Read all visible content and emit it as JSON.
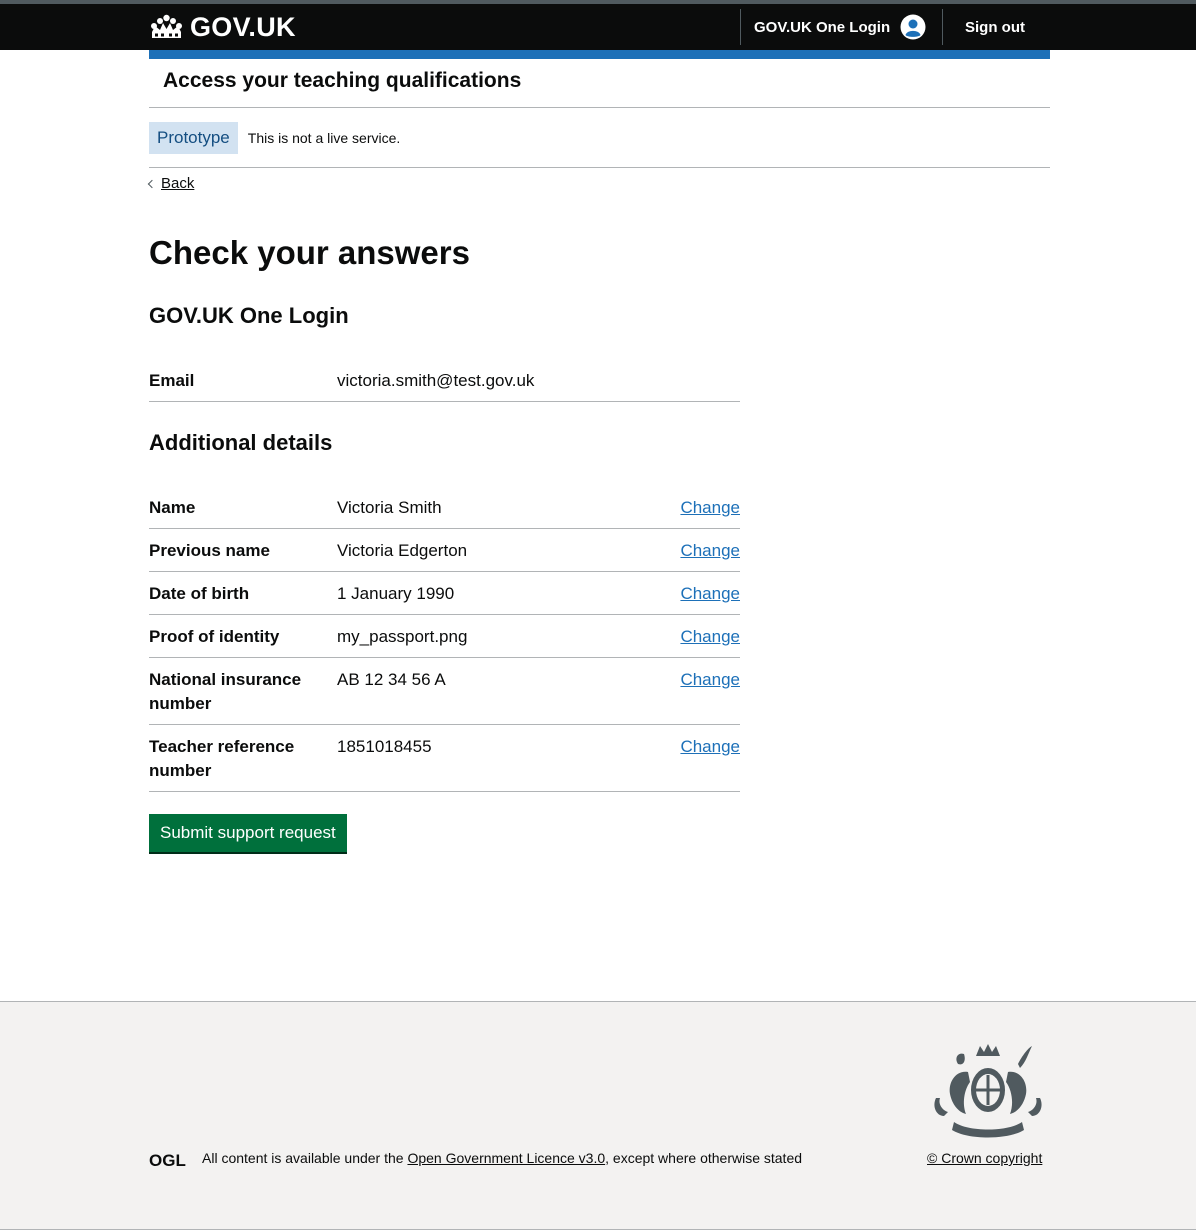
{
  "header": {
    "brand": "GOV.UK",
    "one_login": "GOV.UK One Login",
    "sign_out": "Sign out"
  },
  "service_name": "Access your teaching qualifications",
  "phase_banner": {
    "tag": "Prototype",
    "text": "This is not a live service."
  },
  "back_link": "Back",
  "page_title": "Check your answers",
  "sections": {
    "one_login": {
      "heading": "GOV.UK One Login",
      "rows": [
        {
          "key": "Email",
          "value": "victoria.smith@test.gov.uk",
          "action": ""
        }
      ]
    },
    "additional": {
      "heading": "Additional details",
      "rows": [
        {
          "key": "Name",
          "value": "Victoria Smith",
          "action": "Change"
        },
        {
          "key": "Previous name",
          "value": "Victoria Edgerton",
          "action": "Change"
        },
        {
          "key": "Date of birth",
          "value": "1 January 1990",
          "action": "Change"
        },
        {
          "key": "Proof of identity",
          "value": "my_passport.png",
          "action": "Change"
        },
        {
          "key": "National insurance number",
          "value": "AB 12 34 56 A",
          "action": "Change"
        },
        {
          "key": "Teacher reference number",
          "value": "1851018455",
          "action": "Change"
        }
      ]
    }
  },
  "submit_label": "Submit support request",
  "footer": {
    "ogl": "OGL",
    "licence_prefix": "All content is available under the ",
    "licence_link": "Open Government Licence v3.0",
    "licence_suffix": ", except where otherwise stated",
    "copyright": "© Crown copyright"
  }
}
